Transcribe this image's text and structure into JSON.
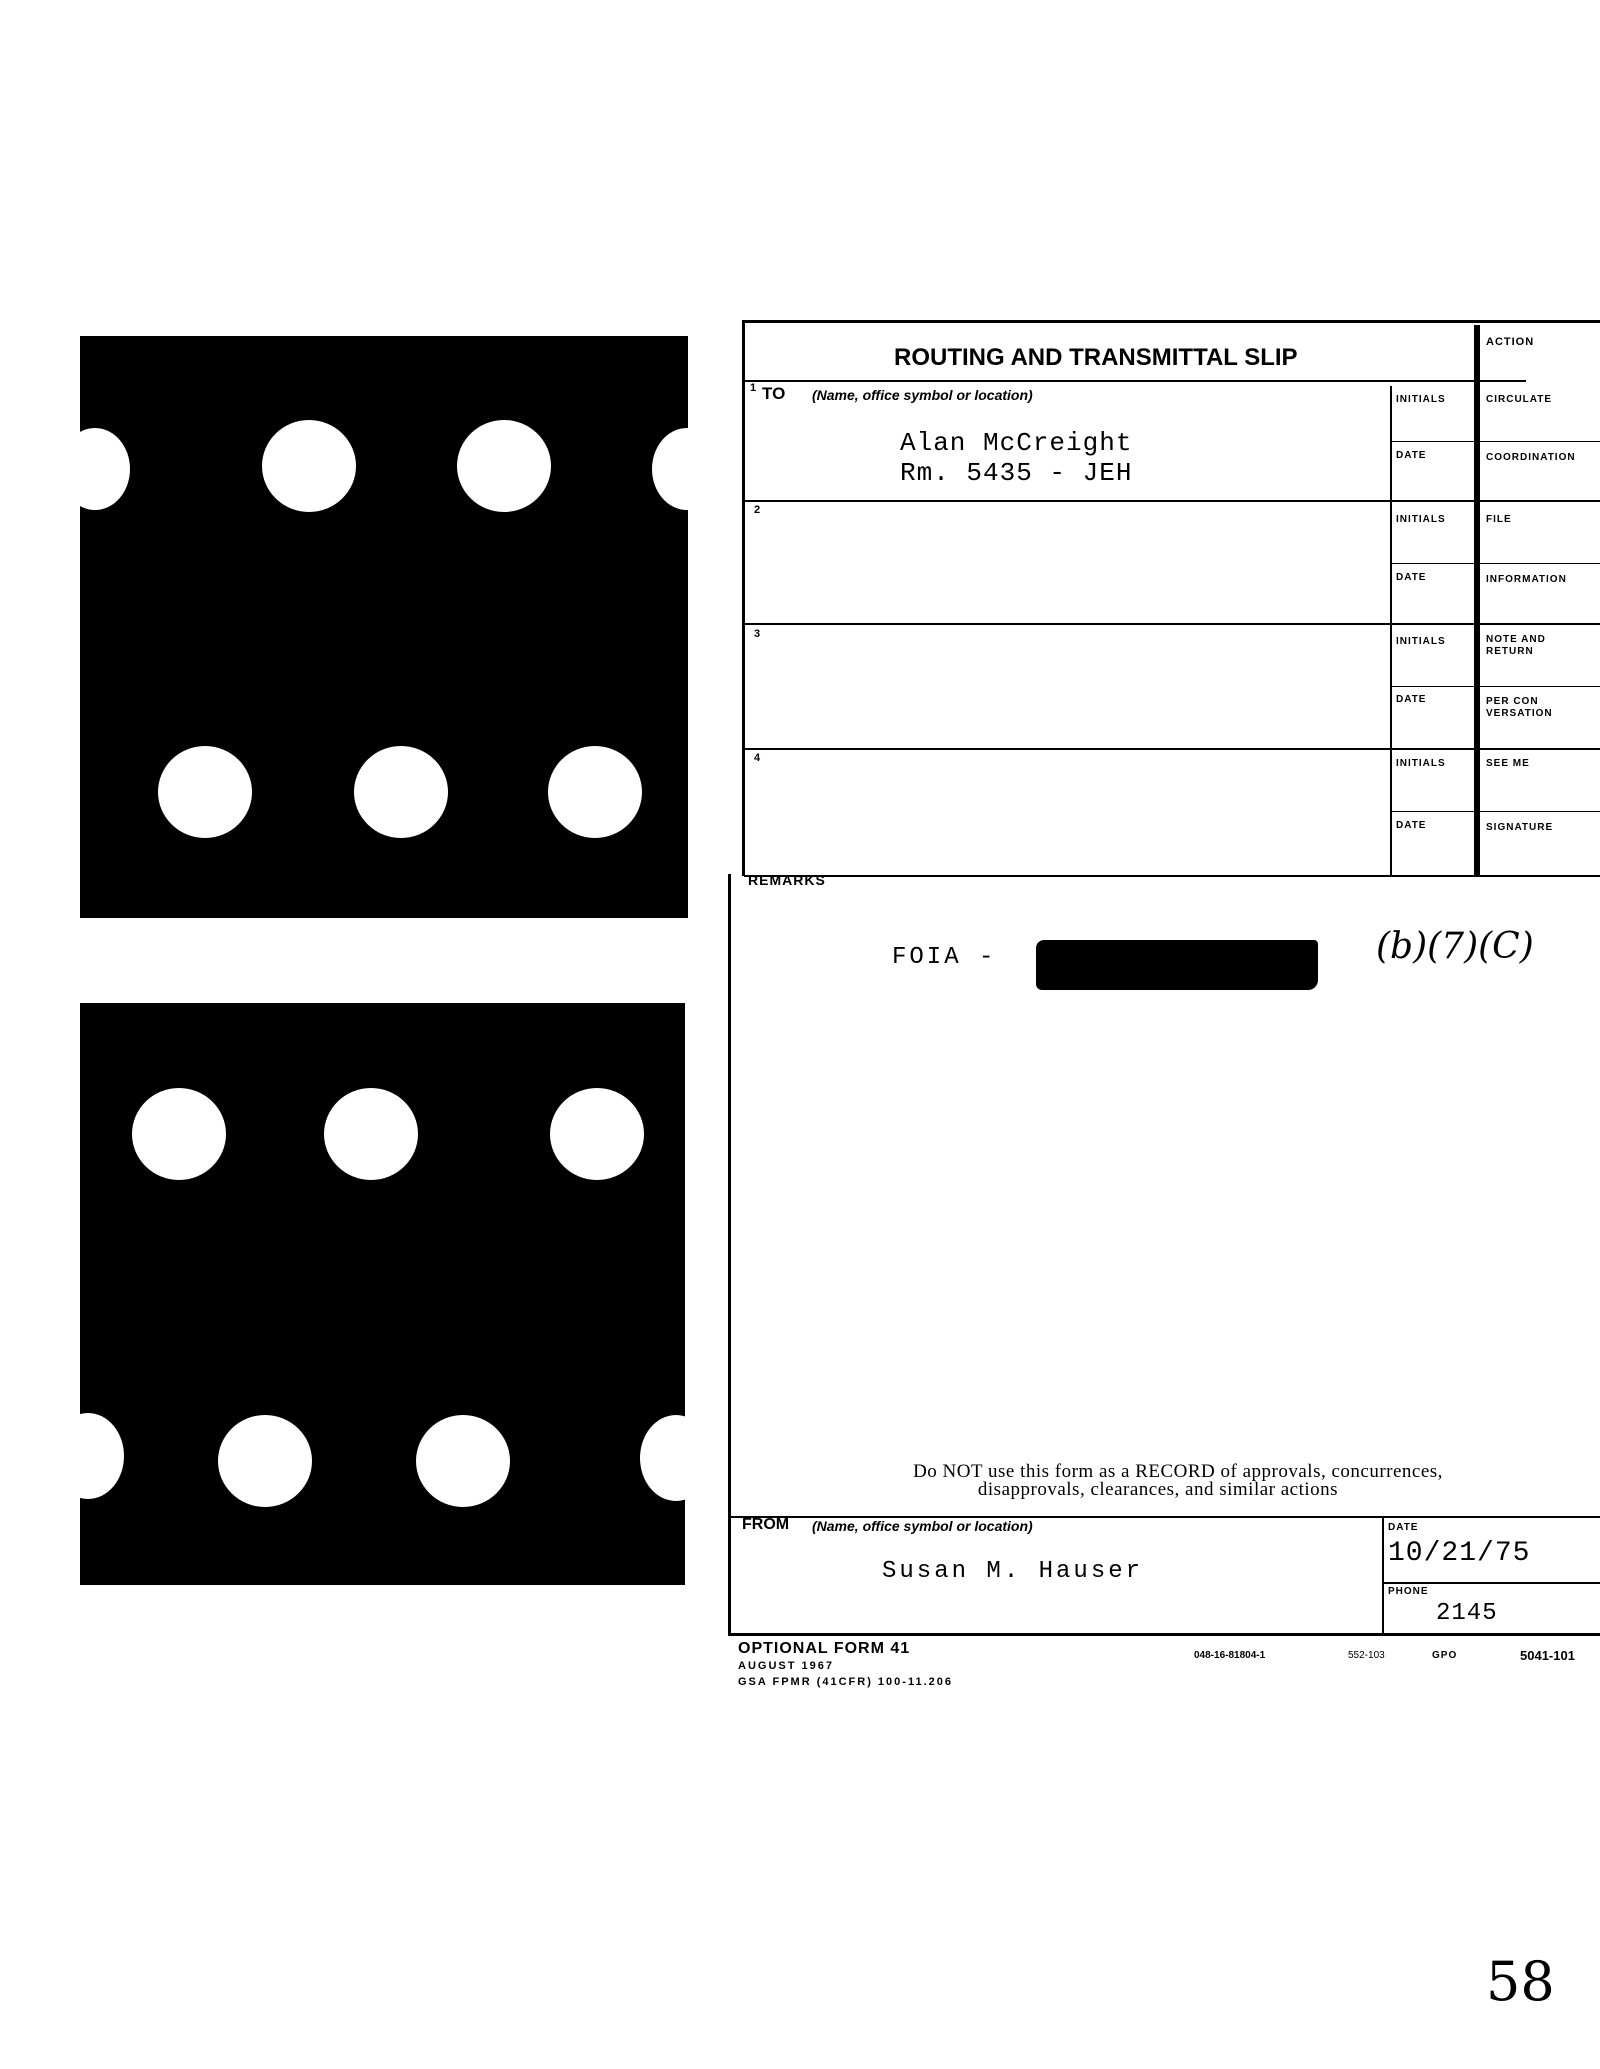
{
  "form": {
    "title": "ROUTING AND TRANSMITTAL SLIP",
    "to_label": "TO",
    "to_hint": "(Name, office symbol or location)",
    "rows": [
      {
        "number": "1",
        "line1": "Alan McCreight",
        "line2": "Rm. 5435 - JEH"
      },
      {
        "number": "2",
        "line1": "",
        "line2": ""
      },
      {
        "number": "3",
        "line1": "",
        "line2": ""
      },
      {
        "number": "4",
        "line1": "",
        "line2": ""
      }
    ],
    "initials_label": "INITIALS",
    "date_label": "DATE",
    "action_header": "ACTION",
    "actions": [
      "CIRCULATE",
      "COORDINATION",
      "FILE",
      "INFORMATION",
      "NOTE AND RETURN",
      "PER CON VERSATION",
      "SEE ME",
      "SIGNATURE"
    ],
    "remarks_label": "REMARKS",
    "remarks_text": "FOIA -",
    "exemption_note": "(b)(7)(C)",
    "notice_line1": "Do NOT use this form as a RECORD of approvals, concurrences,",
    "notice_line2": "disapprovals, clearances, and similar actions",
    "from_label": "FROM",
    "from_hint": "(Name, office symbol or location)",
    "from_name": "Susan M. Hauser",
    "from_date_label": "DATE",
    "from_date": "10/21/75",
    "phone_label": "PHONE",
    "phone": "2145",
    "footer": {
      "form_name": "OPTIONAL FORM 41",
      "form_date": "AUGUST 1967",
      "regulation": "GSA FPMR (41CFR) 100-11.206",
      "print_code": "048-16-81804-1",
      "code2": "552-103",
      "gpo": "GPO",
      "number": "5041-101"
    }
  },
  "page_number": "58"
}
